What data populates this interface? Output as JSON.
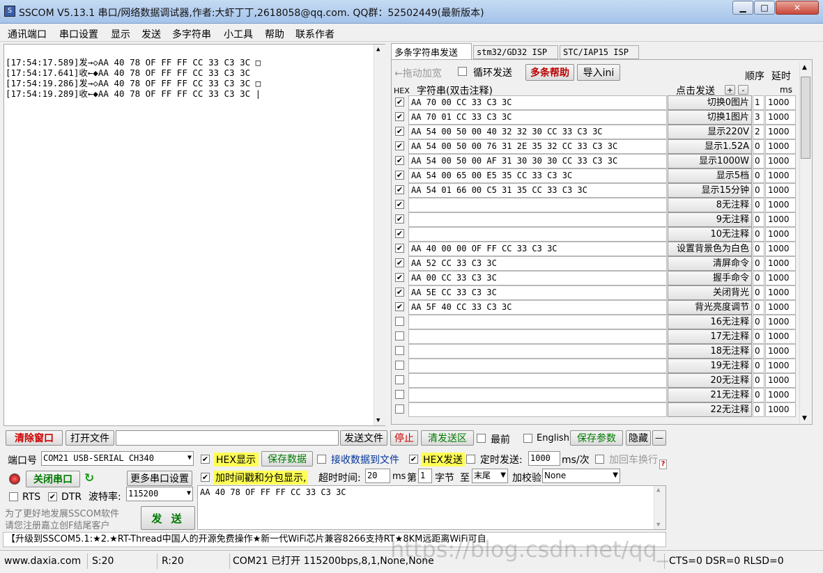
{
  "window": {
    "title": "SSCOM V5.13.1 串口/网络数据调试器,作者:大虾丁丁,2618058@qq.com. QQ群：52502449(最新版本)",
    "minimize": "▁",
    "maximize": "□",
    "close": "✕"
  },
  "menu": [
    "通讯端口",
    "串口设置",
    "显示",
    "发送",
    "多字符串",
    "小工具",
    "帮助",
    "联系作者"
  ],
  "receive_lines": [
    "[17:54:17.589]发→◇AA 40 78 OF FF FF CC 33 C3 3C □",
    "[17:54:17.641]收←◆AA 40 78 OF FF FF CC 33 C3 3C",
    "[17:54:19.286]发→◇AA 40 78 OF FF FF CC 33 C3 3C □",
    "[17:54:19.289]收←◆AA 40 78 OF FF FF CC 33 C3 3C |"
  ],
  "tabs": [
    "多条字符串发送",
    "stm32/GD32 ISP",
    "STC/IAP15 ISP"
  ],
  "multi": {
    "drag_label": "←拖动加宽",
    "loop_send": "循环发送",
    "help": "多条帮助",
    "import_ini": "导入ini",
    "order": "顺序",
    "delay": "延时",
    "hex": "HEX",
    "string_header": "字符串(双击注释)",
    "click_send": "点击发送",
    "plus": "+",
    "minus": "-",
    "ms": "ms",
    "rows": [
      {
        "checked": true,
        "hex": "AA 70 00 CC 33 C3 3C",
        "label": "切换0图片",
        "order": "1",
        "delay": "1000"
      },
      {
        "checked": true,
        "hex": "AA 70 01 CC 33 C3 3C",
        "label": "切换1图片",
        "order": "3",
        "delay": "1000"
      },
      {
        "checked": true,
        "hex": "AA 54 00 50 00 40 32 32 30 CC 33 C3 3C",
        "label": "显示220V",
        "order": "2",
        "delay": "1000"
      },
      {
        "checked": true,
        "hex": "AA 54 00 50 00 76 31 2E 35 32 CC 33 C3 3C",
        "label": "显示1.52A",
        "order": "0",
        "delay": "1000"
      },
      {
        "checked": true,
        "hex": "AA 54 00 50 00 AF 31 30 30 30 CC 33 C3 3C",
        "label": "显示1000W",
        "order": "0",
        "delay": "1000"
      },
      {
        "checked": true,
        "hex": "AA 54 00 65 00 E5 35 CC 33 C3 3C",
        "label": "显示5档",
        "order": "0",
        "delay": "1000"
      },
      {
        "checked": true,
        "hex": "AA 54 01 66 00 C5 31 35 CC 33 C3 3C",
        "label": "显示15分钟",
        "order": "0",
        "delay": "1000"
      },
      {
        "checked": true,
        "hex": "",
        "label": "8无注释",
        "order": "0",
        "delay": "1000"
      },
      {
        "checked": true,
        "hex": "",
        "label": "9无注释",
        "order": "0",
        "delay": "1000"
      },
      {
        "checked": true,
        "hex": "",
        "label": "10无注释",
        "order": "0",
        "delay": "1000"
      },
      {
        "checked": true,
        "hex": "AA 40 00 00 OF FF CC 33 C3 3C",
        "label": "设置背景色为白色",
        "order": "0",
        "delay": "1000"
      },
      {
        "checked": true,
        "hex": "AA 52 CC 33 C3 3C",
        "label": "清屏命令",
        "order": "0",
        "delay": "1000"
      },
      {
        "checked": true,
        "hex": "AA 00 CC 33 C3 3C",
        "label": "握手命令",
        "order": "0",
        "delay": "1000"
      },
      {
        "checked": true,
        "hex": "AA 5E CC 33 C3 3C",
        "label": "关闭背光",
        "order": "0",
        "delay": "1000"
      },
      {
        "checked": true,
        "hex": "AA 5F 40 CC 33 C3 3C",
        "label": "背光亮度调节",
        "order": "0",
        "delay": "1000"
      },
      {
        "checked": false,
        "hex": "",
        "label": "16无注释",
        "order": "0",
        "delay": "1000"
      },
      {
        "checked": false,
        "hex": "",
        "label": "17无注释",
        "order": "0",
        "delay": "1000"
      },
      {
        "checked": false,
        "hex": "",
        "label": "18无注释",
        "order": "0",
        "delay": "1000"
      },
      {
        "checked": false,
        "hex": "",
        "label": "19无注释",
        "order": "0",
        "delay": "1000"
      },
      {
        "checked": false,
        "hex": "",
        "label": "20无注释",
        "order": "0",
        "delay": "1000"
      },
      {
        "checked": false,
        "hex": "",
        "label": "21无注释",
        "order": "0",
        "delay": "1000"
      },
      {
        "checked": false,
        "hex": "",
        "label": "22无注释",
        "order": "0",
        "delay": "1000"
      }
    ]
  },
  "toolbar": {
    "clear_window": "清除窗口",
    "open_file": "打开文件",
    "send_file": "发送文件",
    "stop": "停止",
    "clear_send": "清发送区",
    "topmost": "最前",
    "english": "English",
    "save_params": "保存参数",
    "hide": "隐藏",
    "dash": "—"
  },
  "port": {
    "port_label": "端口号",
    "port_value": "COM21 USB-SERIAL CH340",
    "hex_display": "HEX显示",
    "save_data": "保存数据",
    "recv_to_file": "接收数据到文件",
    "hex_send": "HEX发送",
    "timed_send": "定时发送:",
    "timed_value": "1000",
    "timed_unit": "ms/次",
    "add_crlf": "加回车换行",
    "close_port": "关闭串口",
    "more_settings": "更多串口设置",
    "timestamp": "加时间戳和分包显示,",
    "timeout_label": "超时时间:",
    "timeout_value": "20",
    "ms": "ms",
    "nth": "第",
    "byte_no": "1",
    "byte": "字节",
    "to": "至",
    "tail": "末尾",
    "checksum": "加校验",
    "checksum_value": "None",
    "rts": "RTS",
    "dtr": "DTR",
    "baud_label": "波特率:",
    "baud_value": "115200",
    "send_text": "AA 40 78 OF FF FF CC 33 C3 3C",
    "send_btn": "发 送",
    "promo1": "为了更好地发展SSCOM软件",
    "promo2": "请您注册嘉立创F结尾客户"
  },
  "ticker": "【升级到SSCOM5.1:★2.★RT-Thread中国人的开源免费操作★新一代WiFi芯片兼容8266支持RT★8KM远距离WiFi可自",
  "status": {
    "site": "www.daxia.com",
    "sent": "S:20",
    "recv": "R:20",
    "port_info": "COM21 已打开  115200bps,8,1,None,None",
    "signals": "CTS=0 DSR=0 RLSD=0"
  },
  "watermark": "https://blog.csdn.net/qq_",
  "colors": {
    "red_btn": "#cc0000",
    "green_btn": "#007a00",
    "highlight": "#ffff55"
  }
}
